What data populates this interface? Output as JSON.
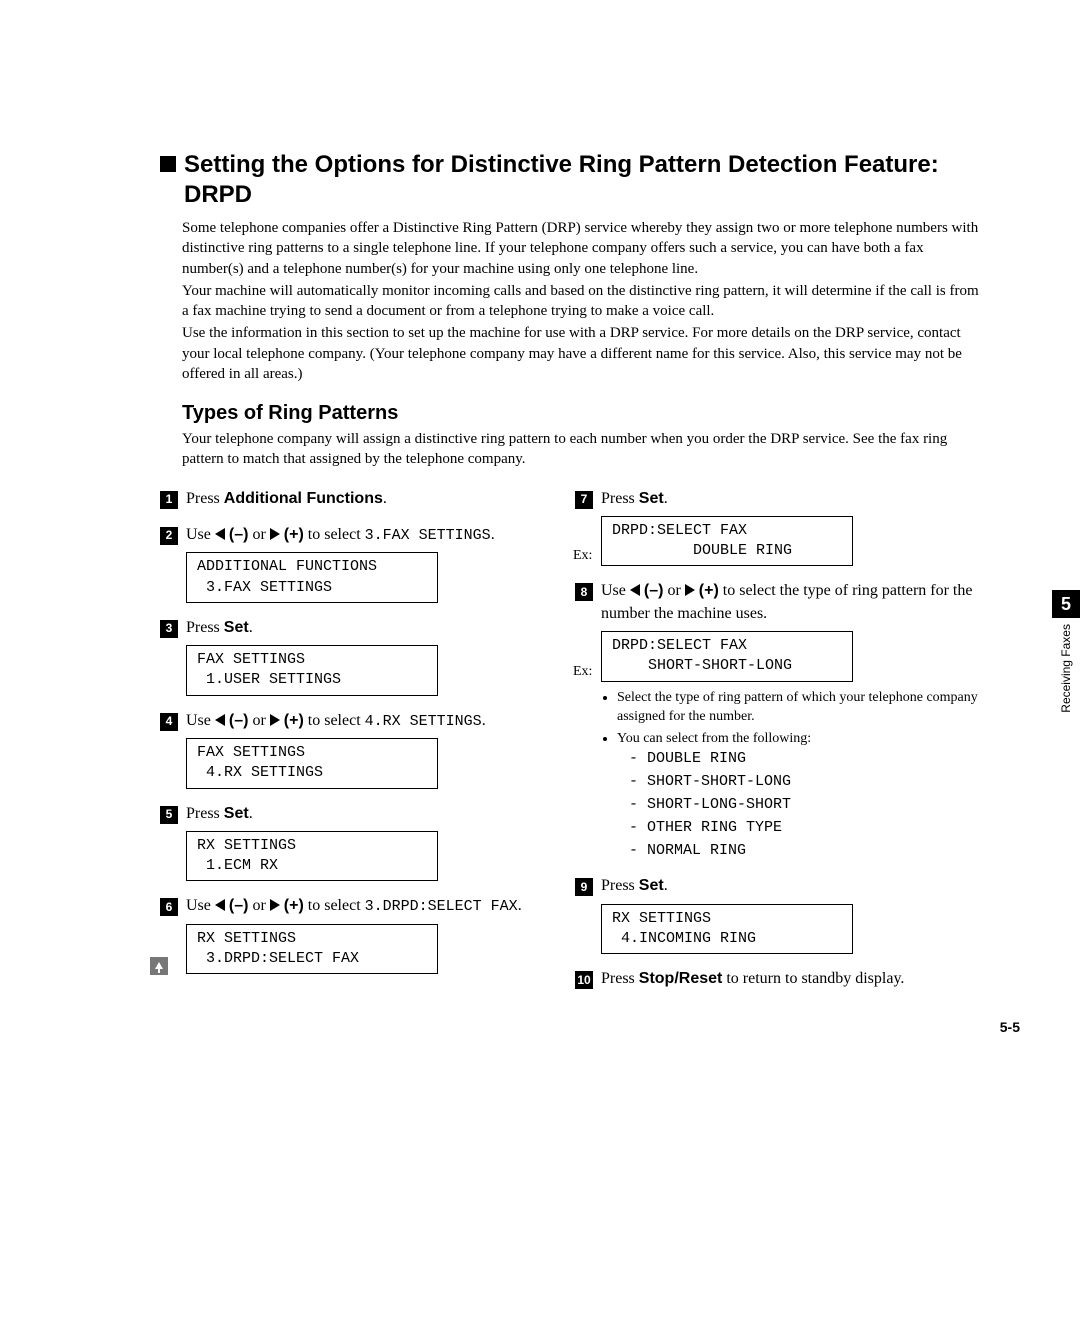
{
  "section": {
    "title": "Setting the Options for Distinctive Ring Pattern Detection Feature: DRPD",
    "intro": [
      "Some telephone companies offer a Distinctive Ring Pattern (DRP) service whereby they assign two or more telephone numbers with distinctive ring patterns to a single telephone line. If your telephone company offers such a service, you can have both a fax number(s) and a telephone number(s) for your machine using only one telephone line.",
      "Your machine will automatically monitor incoming calls and based on the distinctive ring pattern, it will determine if the call is from a fax machine trying to send a document or from a telephone trying to make a voice call.",
      "Use the information in this section to set up the machine for use with a DRP service. For more details on the DRP service, contact your local telephone company. (Your telephone company may have a different name for this service. Also, this service may not be offered in all areas.)"
    ]
  },
  "subsection": {
    "title": "Types of Ring Patterns",
    "intro": "Your telephone company will assign a distinctive ring pattern to each number when you order the DRP service. See the fax ring pattern to match that assigned by the telephone company."
  },
  "steps": {
    "s1": {
      "pre": "Press ",
      "bold": "Additional Functions",
      "post": "."
    },
    "s2": {
      "pre": "Use ",
      "mid": " to select ",
      "code": "3.FAX SETTINGS",
      "post": ".",
      "lcd": "ADDITIONAL FUNCTIONS\n 3.FAX SETTINGS"
    },
    "s3": {
      "pre": "Press ",
      "bold": "Set",
      "post": ".",
      "lcd": "FAX SETTINGS\n 1.USER SETTINGS"
    },
    "s4": {
      "pre": "Use ",
      "mid": " to select ",
      "code": "4.RX SETTINGS",
      "post": ".",
      "lcd": "FAX SETTINGS\n 4.RX SETTINGS"
    },
    "s5": {
      "pre": "Press ",
      "bold": "Set",
      "post": ".",
      "lcd": "RX SETTINGS\n 1.ECM RX"
    },
    "s6": {
      "pre": "Use ",
      "mid": " to select ",
      "code": "3.DRPD:SELECT FAX",
      "post": ".",
      "lcd": "RX SETTINGS\n 3.DRPD:SELECT FAX"
    },
    "s7": {
      "pre": "Press ",
      "bold": "Set",
      "post": ".",
      "ex": "Ex:",
      "lcd": "DRPD:SELECT FAX\n         DOUBLE RING"
    },
    "s8": {
      "pre": "Use ",
      "mid": " to select the type of ring pattern for the number the machine uses.",
      "ex": "Ex:",
      "lcd": "DRPD:SELECT FAX\n    SHORT-SHORT-LONG",
      "bullets": {
        "b1": "Select the type of ring pattern of which your telephone company assigned for the number.",
        "b2": "You can select from the following:",
        "opts": [
          "DOUBLE RING",
          "SHORT-SHORT-LONG",
          "SHORT-LONG-SHORT",
          "OTHER RING TYPE",
          "NORMAL RING"
        ]
      }
    },
    "s9": {
      "pre": "Press ",
      "bold": "Set",
      "post": ".",
      "lcd": "RX SETTINGS\n 4.INCOMING RING"
    },
    "s10": {
      "pre": "Press ",
      "bold": "Stop/Reset",
      "post": " to return to standby display."
    }
  },
  "arrow_labels": {
    "minus": "(–)",
    "plus": "(+)",
    "or": " or "
  },
  "side": {
    "chapter": "5",
    "label": "Receiving Faxes"
  },
  "page_num": "5-5"
}
